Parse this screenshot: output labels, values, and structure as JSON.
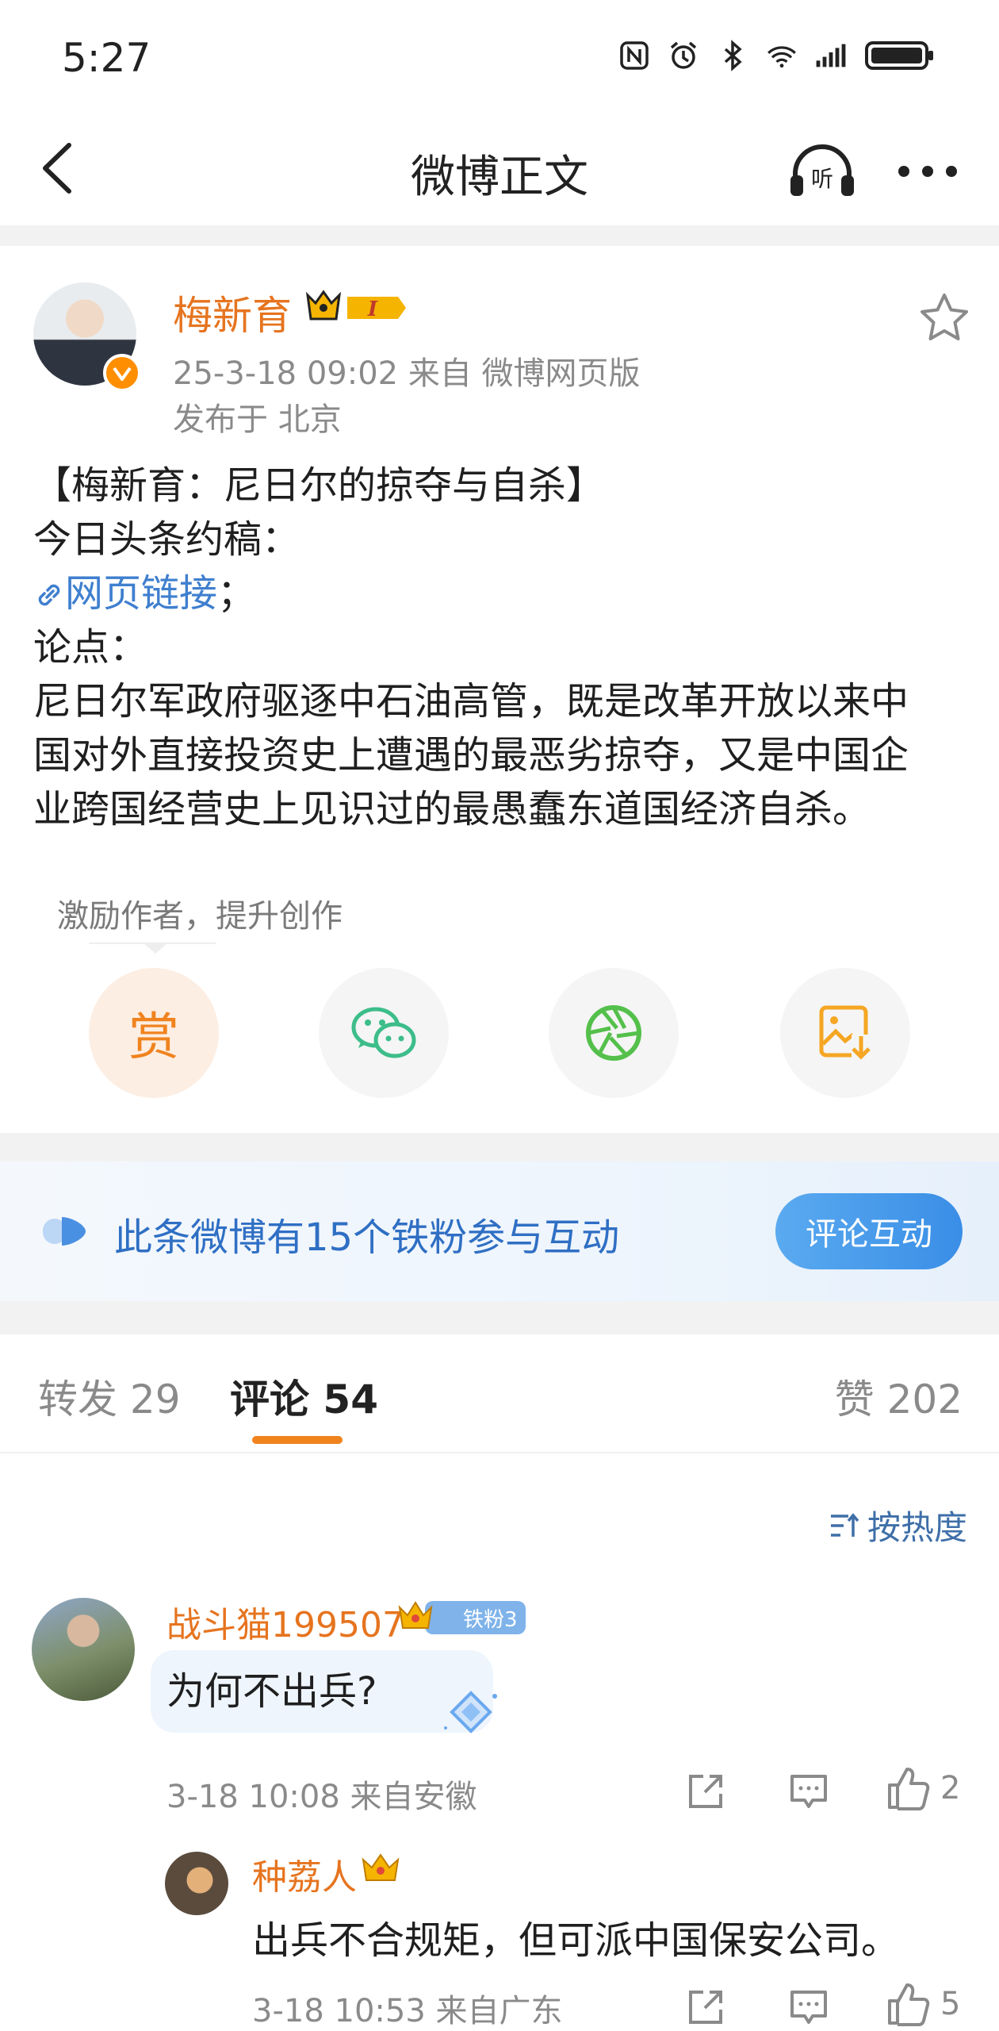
{
  "status_bar": {
    "time": "5:27"
  },
  "nav": {
    "title": "微博正文"
  },
  "post": {
    "author": "梅新育",
    "meta": "25-3-18 09:02  来自 微博网页版",
    "location": "发布于 北京",
    "lines": [
      "【梅新育：尼日尔的掠夺与自杀】",
      "今日头条约稿：",
      "论点：",
      "尼日尔军政府驱逐中石油高管，既是改革开放以来中",
      "国对外直接投资史上遭遇的最恶劣掠夺，又是中国企",
      "业跨国经营史上见识过的最愚蠢东道国经济自杀。"
    ],
    "link_text": "网页链接",
    "link_suffix": "；"
  },
  "reward": {
    "tip": "激励作者，提升创作",
    "reward_glyph": "赏"
  },
  "banner": {
    "text": "此条微博有15个铁粉参与互动",
    "button": "评论互动"
  },
  "tabs": {
    "repost": "转发 29",
    "comments": "评论 54",
    "likes": "赞 202"
  },
  "sort": {
    "label": "按热度"
  },
  "comments": [
    {
      "name": "战斗猫199507",
      "fan_badge": "铁粉3",
      "text": "为何不出兵?",
      "meta": "3-18 10:08 来自安徽",
      "likes": "2"
    },
    {
      "name": "种荔人",
      "text": "出兵不合规矩，但可派中国保安公司。",
      "meta": "3-18 10:53 来自广东",
      "likes": "5"
    }
  ],
  "colors": {
    "accent_orange": "#f0831e",
    "link_blue": "#3f7fcf",
    "banner_blue": "#3a8ee6"
  }
}
